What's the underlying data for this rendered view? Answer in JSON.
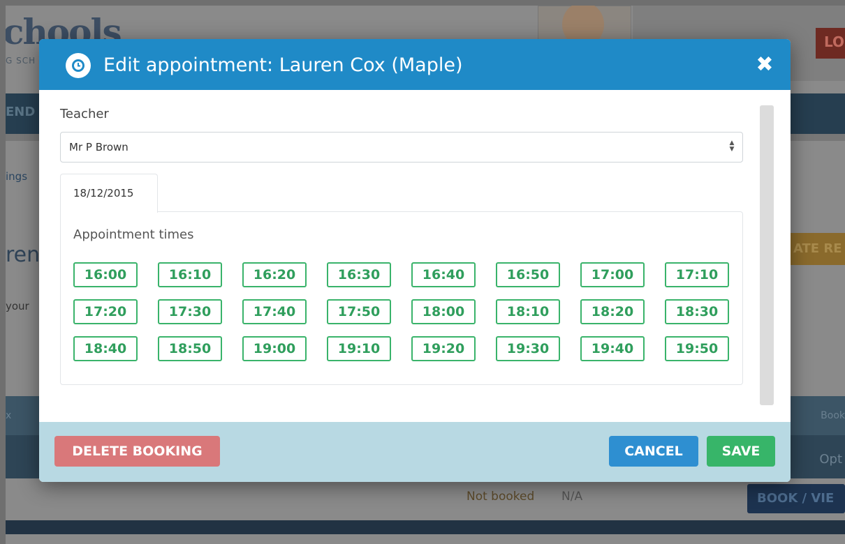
{
  "background": {
    "logo": "chools",
    "logo_sub": "G SCH",
    "logout": "LO",
    "nav_text": "END",
    "link_text": "ings",
    "heading": "ren",
    "body_text": "your",
    "orange_button": "ATE RE",
    "band1_left": "x",
    "band1_right": "Book",
    "band2_right": "Opt",
    "status": "Not booked",
    "na": "N/A",
    "book_view": "BOOK / VIE"
  },
  "modal": {
    "icon": "clock-icon",
    "title": "Edit appointment: Lauren Cox (Maple)",
    "close_icon": "close-icon",
    "teacher_label": "Teacher",
    "teacher_value": "Mr P Brown",
    "date_tab": "18/12/2015",
    "times_label": "Appointment times",
    "slots": [
      "16:00",
      "16:10",
      "16:20",
      "16:30",
      "16:40",
      "16:50",
      "17:00",
      "17:10",
      "17:20",
      "17:30",
      "17:40",
      "17:50",
      "18:00",
      "18:10",
      "18:20",
      "18:30",
      "18:40",
      "18:50",
      "19:00",
      "19:10",
      "19:20",
      "19:30",
      "19:40",
      "19:50"
    ],
    "delete_label": "DELETE BOOKING",
    "cancel_label": "CANCEL",
    "save_label": "SAVE"
  },
  "colors": {
    "header": "#1f8ac7",
    "slot_green": "#39b36a",
    "delete": "#d9787a",
    "cancel": "#2e8fd1",
    "save": "#37b569",
    "footer": "#b8d9e3"
  }
}
